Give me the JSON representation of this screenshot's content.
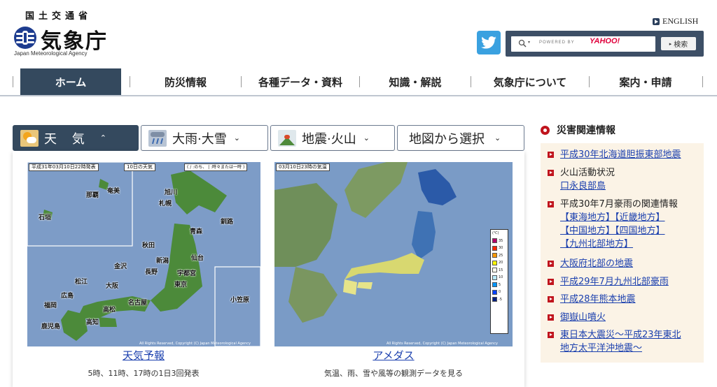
{
  "header": {
    "ministry": "国土交通省",
    "agency_name": "気象庁",
    "agency_en": "Japan Meteorological Agency",
    "english_link": "ENGLISH",
    "search": {
      "powered_by": "POWERED BY",
      "provider": "YAHOO!",
      "button": "検索"
    }
  },
  "nav": {
    "items": [
      "ホーム",
      "防災情報",
      "各種データ・資料",
      "知識・解説",
      "気象庁について",
      "案内・申請"
    ],
    "active": "ホーム"
  },
  "tabs": [
    {
      "label": "天 気",
      "icon": "sun-cloud-icon",
      "active": true
    },
    {
      "label": "大雨·大雪",
      "icon": "rain-snow-icon"
    },
    {
      "label": "地震·火山",
      "icon": "volcano-icon"
    },
    {
      "label": "地図から選択",
      "icon": ""
    }
  ],
  "forecast": {
    "header_date": "平成31年03月10日22時発表",
    "header_title": "10日の天気",
    "header_note": "( / :のち、 | :時々または一時 )",
    "cities": [
      "那覇",
      "奄美",
      "石垣",
      "旭川",
      "札幌",
      "釧路",
      "青森",
      "秋田",
      "仙台",
      "新潟",
      "金沢",
      "長野",
      "宇都宮",
      "東京",
      "名古屋",
      "大阪",
      "松江",
      "広島",
      "高松",
      "福岡",
      "高知",
      "鹿児島",
      "小笠原"
    ],
    "copyright": "All Rights Reserved, Copyright (C) Japan Meteorological Agency",
    "link": "天気予報",
    "desc": "5時、11時、17時の1日3回発表"
  },
  "amedas": {
    "header": "03月10日23時の気温",
    "legend_unit": "(℃)",
    "legend_values": [
      "35",
      "30",
      "25",
      "20",
      "15",
      "10",
      "5",
      "0",
      "-5"
    ],
    "copyright": "All Rights Reserved, Copyright (C) Japan Meteorological Agency",
    "link": "アメダス",
    "desc": "気温、雨、雪や風等の観測データを見る"
  },
  "disaster": {
    "title": "災害関連情報",
    "items": [
      {
        "lines": [
          "平成30年北海道胆振東部地震"
        ],
        "link": true
      },
      {
        "lines": [
          "火山活動状況",
          "口永良部島"
        ],
        "link": "partial"
      },
      {
        "lines": [
          "平成30年7月豪雨の関連情報",
          "【東海地方】【近畿地方】",
          "【中国地方】【四国地方】",
          "【九州北部地方】"
        ],
        "link": "partial"
      },
      {
        "lines": [
          "大阪府北部の地震"
        ],
        "link": true
      },
      {
        "lines": [
          "平成29年7月九州北部豪雨"
        ],
        "link": true
      },
      {
        "lines": [
          "平成28年熊本地震"
        ],
        "link": true
      },
      {
        "lines": [
          "御嶽山噴火"
        ],
        "link": true
      },
      {
        "lines": [
          "東日本大震災～平成23年東北",
          "地方太平洋沖地震～"
        ],
        "link": true
      }
    ]
  },
  "colors": {
    "nav_active": "#34495e",
    "link": "#1a3fae",
    "accent_red": "#c0141d",
    "sidebar_bg": "#fbf3e6",
    "twitter": "#3aa1e0"
  }
}
